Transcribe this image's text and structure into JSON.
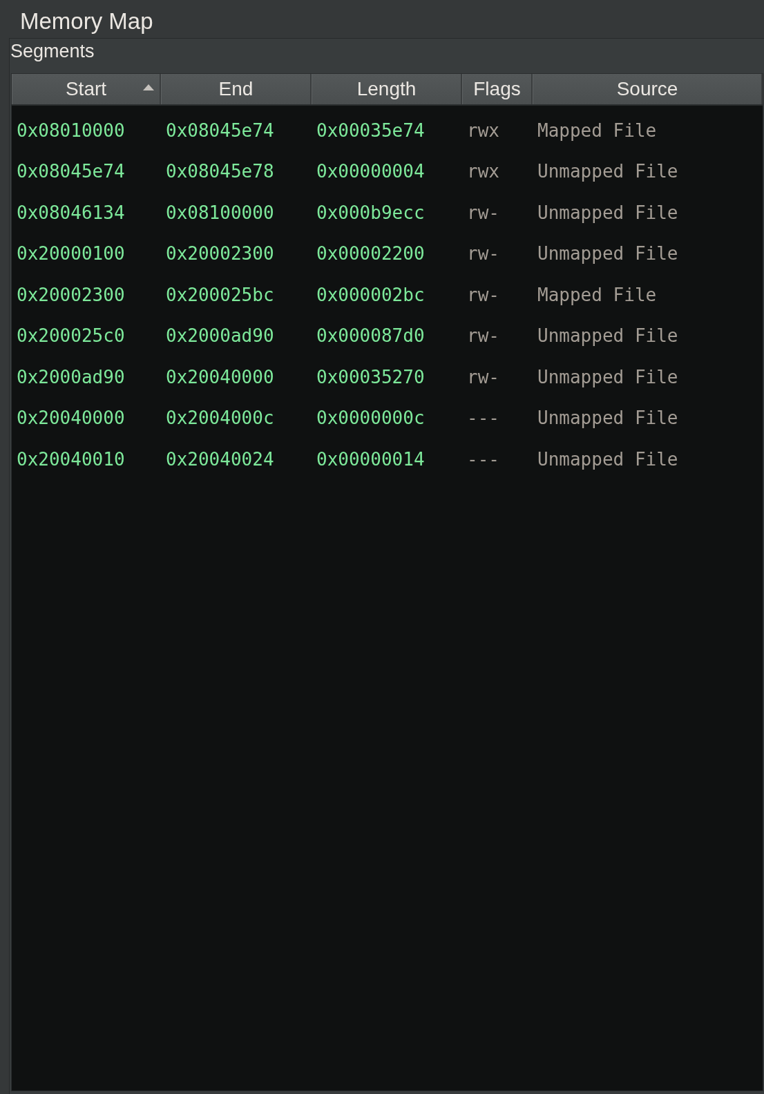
{
  "window": {
    "title": "Memory Map"
  },
  "panel": {
    "title": "Segments"
  },
  "table": {
    "columns": [
      {
        "label": "Start",
        "sorted": true,
        "kind": "address"
      },
      {
        "label": "End",
        "sorted": false,
        "kind": "address"
      },
      {
        "label": "Length",
        "sorted": false,
        "kind": "address"
      },
      {
        "label": "Flags",
        "sorted": false,
        "kind": "text"
      },
      {
        "label": "Source",
        "sorted": false,
        "kind": "text"
      }
    ],
    "rows": [
      [
        "0x08010000",
        "0x08045e74",
        "0x00035e74",
        "rwx",
        "Mapped File"
      ],
      [
        "0x08045e74",
        "0x08045e78",
        "0x00000004",
        "rwx",
        "Unmapped File"
      ],
      [
        "0x08046134",
        "0x08100000",
        "0x000b9ecc",
        "rw-",
        "Unmapped File"
      ],
      [
        "0x20000100",
        "0x20002300",
        "0x00002200",
        "rw-",
        "Unmapped File"
      ],
      [
        "0x20002300",
        "0x200025bc",
        "0x000002bc",
        "rw-",
        "Mapped File"
      ],
      [
        "0x200025c0",
        "0x2000ad90",
        "0x000087d0",
        "rw-",
        "Unmapped File"
      ],
      [
        "0x2000ad90",
        "0x20040000",
        "0x00035270",
        "rw-",
        "Unmapped File"
      ],
      [
        "0x20040000",
        "0x2004000c",
        "0x0000000c",
        "---",
        "Unmapped File"
      ],
      [
        "0x20040010",
        "0x20040024",
        "0x00000014",
        "---",
        "Unmapped File"
      ]
    ]
  }
}
